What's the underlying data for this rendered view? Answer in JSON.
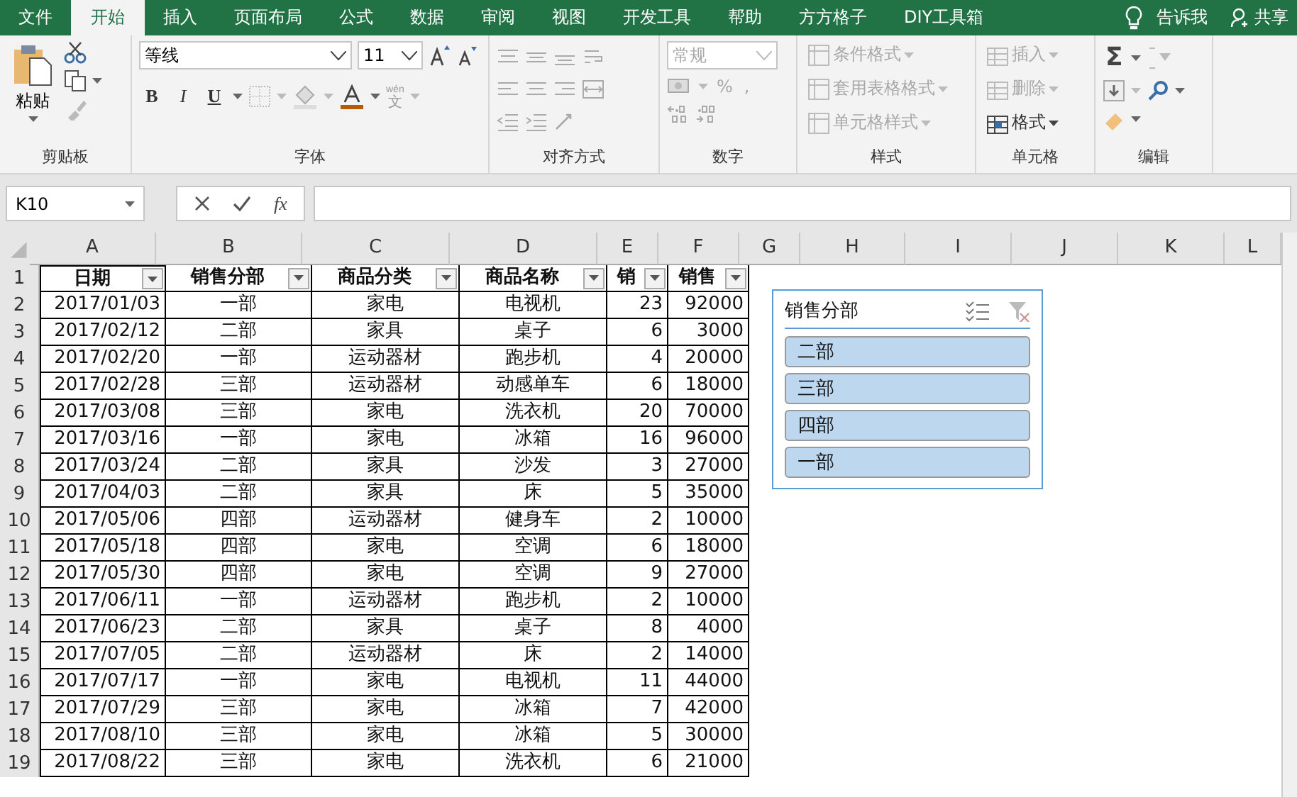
{
  "menu_tabs": [
    {
      "label": "文件",
      "selected": false
    },
    {
      "label": "开始",
      "selected": true
    },
    {
      "label": "插入",
      "selected": false
    },
    {
      "label": "页面布局",
      "selected": false
    },
    {
      "label": "公式",
      "selected": false
    },
    {
      "label": "数据",
      "selected": false
    },
    {
      "label": "审阅",
      "selected": false
    },
    {
      "label": "视图",
      "selected": false
    },
    {
      "label": "开发工具",
      "selected": false
    },
    {
      "label": "帮助",
      "selected": false
    },
    {
      "label": "方方格子",
      "selected": false
    },
    {
      "label": "DIY工具箱",
      "selected": false
    }
  ],
  "tell_me": "告诉我",
  "share": "共享",
  "ribbon": {
    "clipboard": {
      "label": "剪贴板",
      "paste": "粘贴"
    },
    "font": {
      "label": "字体",
      "font_name": "等线",
      "font_size": "11",
      "bold": "B",
      "italic": "I",
      "underline": "U",
      "phonetic_top": "wén",
      "phonetic_bottom": "文"
    },
    "alignment": {
      "label": "对齐方式"
    },
    "number": {
      "label": "数字",
      "format": "常规",
      "percent": "%",
      "comma": ","
    },
    "styles": {
      "label": "样式",
      "items": [
        {
          "label": "条件格式",
          "disabled": true
        },
        {
          "label": "套用表格格式",
          "disabled": true
        },
        {
          "label": "单元格样式",
          "disabled": true
        }
      ]
    },
    "cells": {
      "label": "单元格",
      "items": [
        {
          "label": "插入",
          "disabled": true
        },
        {
          "label": "删除",
          "disabled": true
        },
        {
          "label": "格式",
          "disabled": false
        }
      ]
    },
    "editing": {
      "label": "编辑",
      "sum": "Σ"
    }
  },
  "formula_bar": {
    "name_box": "K10",
    "function_label": "fx"
  },
  "sheet": {
    "columns": [
      "A",
      "B",
      "C",
      "D",
      "E",
      "F",
      "G",
      "H",
      "I",
      "J",
      "K",
      "L"
    ],
    "row_numbers": [
      "1",
      "2",
      "3",
      "4",
      "5",
      "6",
      "7",
      "8",
      "9",
      "10",
      "11",
      "12",
      "13",
      "14",
      "15",
      "16",
      "17",
      "18",
      "19"
    ],
    "header": [
      "日期",
      "销售分部",
      "商品分类",
      "商品名称",
      "销",
      "销售"
    ],
    "rows": [
      [
        "2017/01/03",
        "一部",
        "家电",
        "电视机",
        "23",
        "92000"
      ],
      [
        "2017/02/12",
        "二部",
        "家具",
        "桌子",
        "6",
        "3000"
      ],
      [
        "2017/02/20",
        "一部",
        "运动器材",
        "跑步机",
        "4",
        "20000"
      ],
      [
        "2017/02/28",
        "三部",
        "运动器材",
        "动感单车",
        "6",
        "18000"
      ],
      [
        "2017/03/08",
        "三部",
        "家电",
        "洗衣机",
        "20",
        "70000"
      ],
      [
        "2017/03/16",
        "一部",
        "家电",
        "冰箱",
        "16",
        "96000"
      ],
      [
        "2017/03/24",
        "二部",
        "家具",
        "沙发",
        "3",
        "27000"
      ],
      [
        "2017/04/03",
        "二部",
        "家具",
        "床",
        "5",
        "35000"
      ],
      [
        "2017/05/06",
        "四部",
        "运动器材",
        "健身车",
        "2",
        "10000"
      ],
      [
        "2017/05/18",
        "四部",
        "家电",
        "空调",
        "6",
        "18000"
      ],
      [
        "2017/05/30",
        "四部",
        "家电",
        "空调",
        "9",
        "27000"
      ],
      [
        "2017/06/11",
        "一部",
        "运动器材",
        "跑步机",
        "2",
        "10000"
      ],
      [
        "2017/06/23",
        "二部",
        "家具",
        "桌子",
        "8",
        "4000"
      ],
      [
        "2017/07/05",
        "二部",
        "运动器材",
        "床",
        "2",
        "14000"
      ],
      [
        "2017/07/17",
        "一部",
        "家电",
        "电视机",
        "11",
        "44000"
      ],
      [
        "2017/07/29",
        "三部",
        "家电",
        "冰箱",
        "7",
        "42000"
      ],
      [
        "2017/08/10",
        "三部",
        "家电",
        "冰箱",
        "5",
        "30000"
      ],
      [
        "2017/08/22",
        "三部",
        "家电",
        "洗衣机",
        "6",
        "21000"
      ]
    ]
  },
  "slicer": {
    "title": "销售分部",
    "items": [
      {
        "label": "二部",
        "selected": true
      },
      {
        "label": "三部",
        "selected": true
      },
      {
        "label": "四部",
        "selected": true
      },
      {
        "label": "一部",
        "selected": true
      }
    ]
  }
}
